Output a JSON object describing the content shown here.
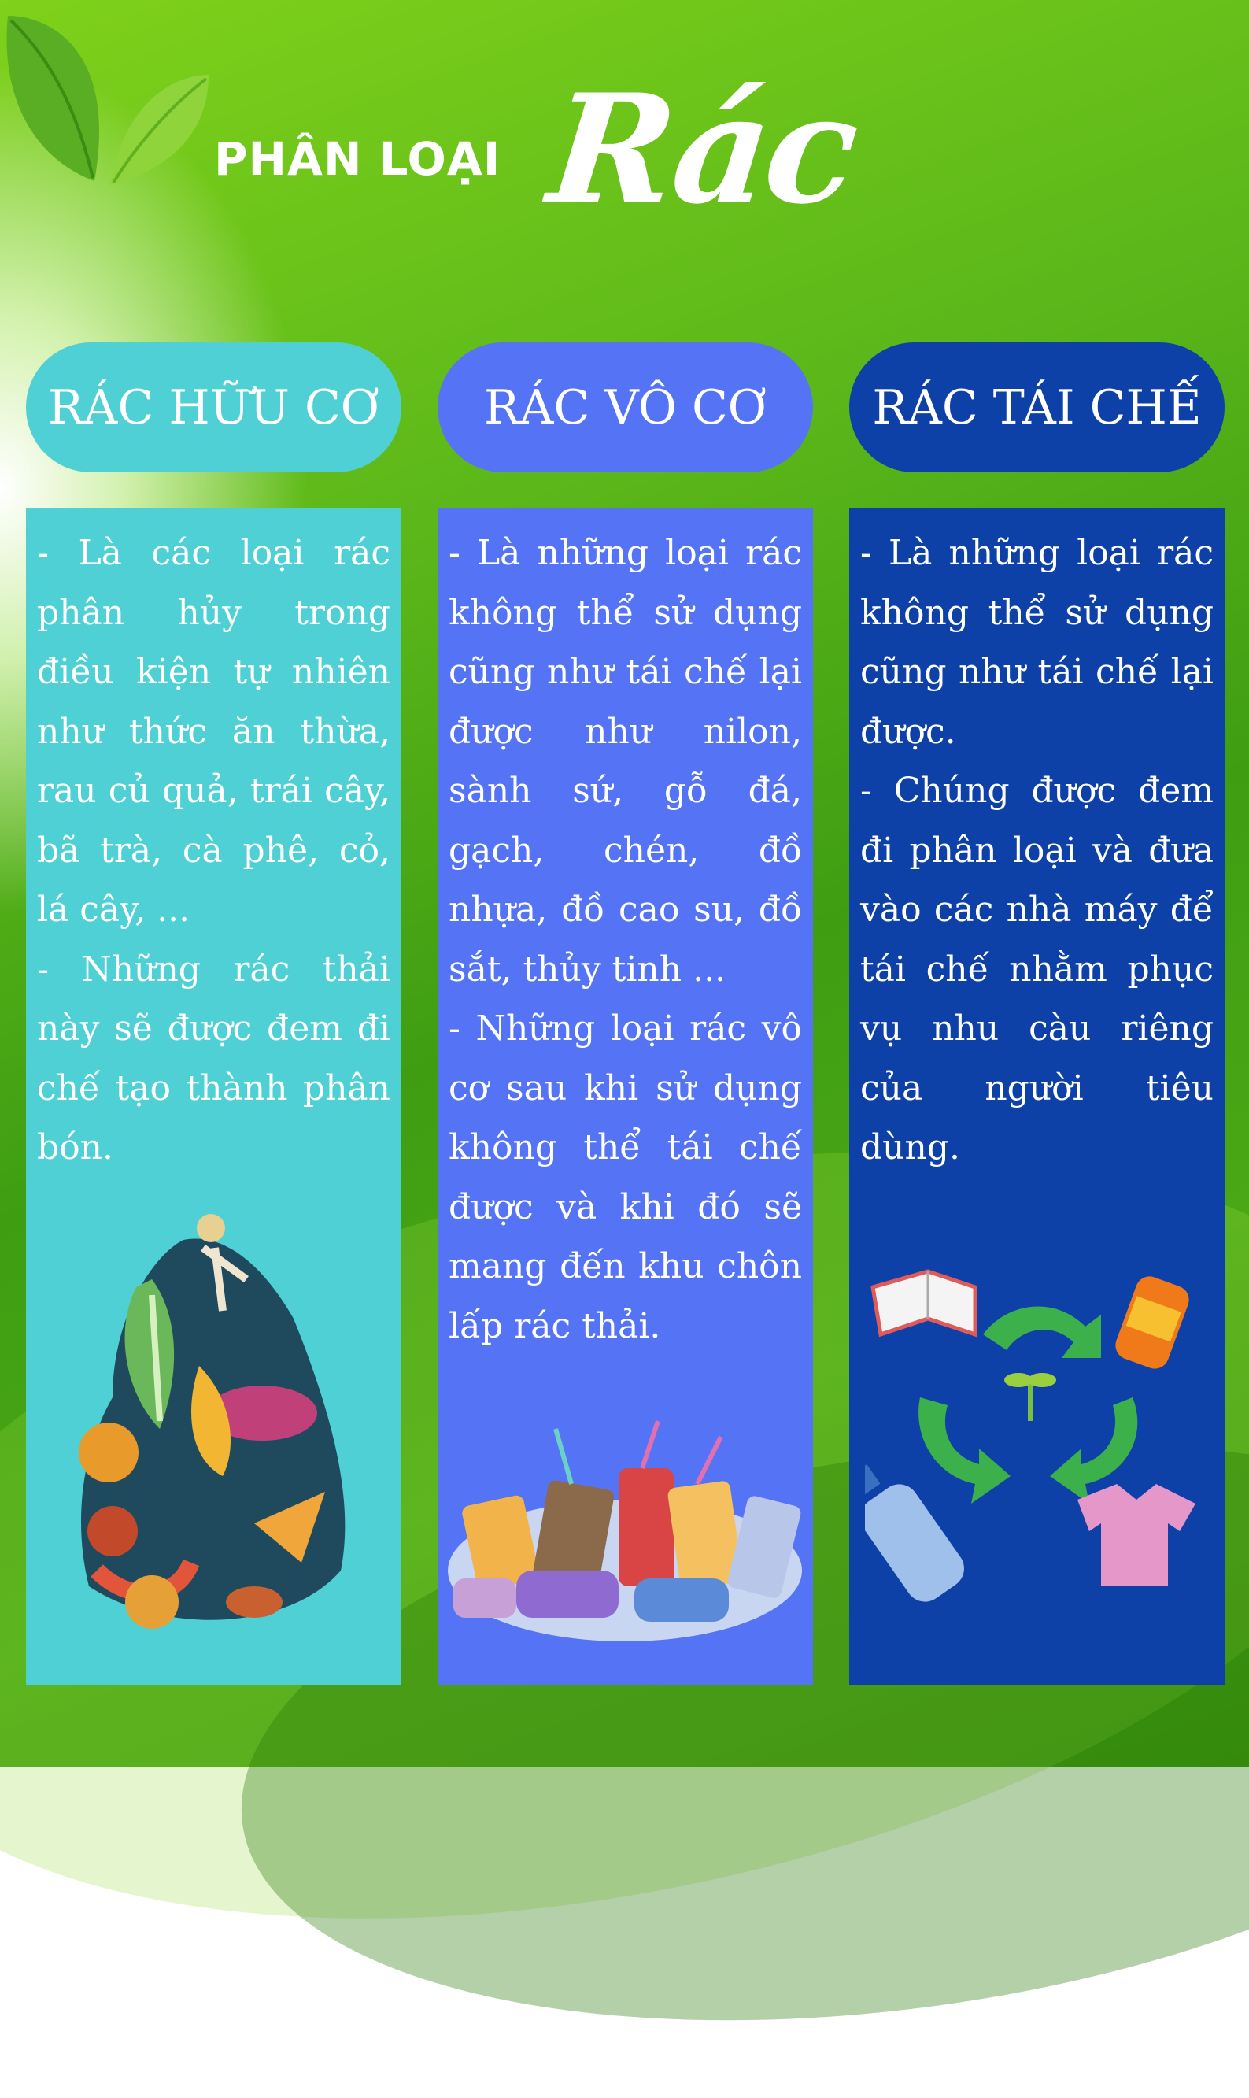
{
  "title": {
    "prefix": "PHÂN LOẠI",
    "main": "Rác"
  },
  "columns": [
    {
      "heading": "RÁC HỮU CƠ",
      "paragraphs": [
        "- Là các loại rác phân hủy trong điều kiện tự nhiên như thức ăn thừa, rau củ quả, trái cây, bã trà, cà phê, cỏ, lá cây, ...",
        "- Những rác thải này sẽ được đem đi chế tạo thành phân bón."
      ],
      "image": "organic-waste-pile"
    },
    {
      "heading": "RÁC VÔ CƠ",
      "paragraphs": [
        "- Là những loại rác không thể sử dụng cũng như tái chế lại được như nilon, sành sứ, gỗ đá, gạch, chén, đồ nhựa, đồ cao su, đồ sắt, thủy tinh ...",
        "- Những loại rác vô cơ sau khi sử dụng không thể tái chế được và khi đó sẽ mang đến khu chôn lấp rác thải."
      ],
      "image": "plastic-waste-pile"
    },
    {
      "heading": "RÁC TÁI CHẾ",
      "paragraphs": [
        "- Là những loại rác không thể sử dụng cũng như tái chế lại được.",
        "- Chúng được đem đi phân loại và đưa vào các nhà máy để tái chế nhằm phục vụ nhu càu riêng của người tiêu dùng."
      ],
      "image": "recycling-symbol"
    }
  ],
  "colors": {
    "organic": "#4fd0d4",
    "inorganic": "#5574f5",
    "recycle": "#0e41a8",
    "background": "#5cb81a"
  }
}
